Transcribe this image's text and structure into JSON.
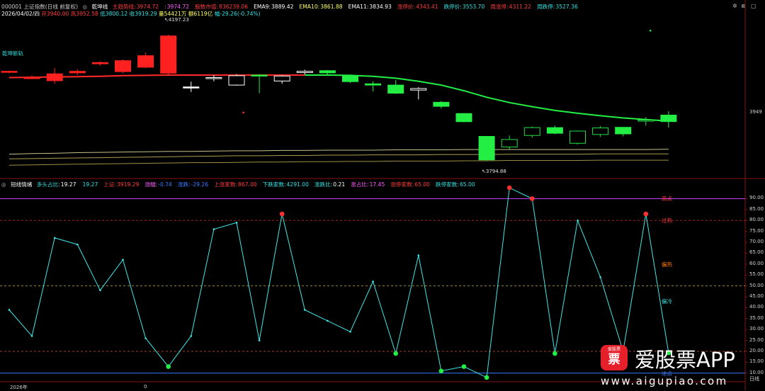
{
  "window": {
    "title": "000001 上证指数(日线 前复权)",
    "main_indicator": "乾坤线",
    "sub_indicator": "短线情绪"
  },
  "header_main": [
    {
      "label": "主趋势线:",
      "value": "3974.72",
      "color": "#ff3b3b",
      "lc": "#ff3b3b"
    },
    {
      "label": ":",
      "value": "3974.72",
      "color": "#ff5aff",
      "lc": "#ff5aff"
    },
    {
      "label": "股数市值:",
      "value": "836239.06",
      "color": "#ff3b3b",
      "lc": "#ff3b3b"
    },
    {
      "label": "EMA9:",
      "value": "3889.42",
      "color": "#ffffff",
      "lc": "#ffffff"
    },
    {
      "label": "EMA10:",
      "value": "3861.88",
      "color": "#ffff66",
      "lc": "#ffff66"
    },
    {
      "label": "EMA11:",
      "value": "3834.93",
      "color": "#ffffff",
      "lc": "#ffffff"
    },
    {
      "label": "涨停价:",
      "value": "4343.41",
      "color": "#ff3b3b",
      "lc": "#ff3b3b"
    },
    {
      "label": "跌停价:",
      "value": "3553.70",
      "color": "#33e0e0",
      "lc": "#33e0e0"
    },
    {
      "label": "周涨停:",
      "value": "4311.22",
      "color": "#ff3b3b",
      "lc": "#ff3b3b"
    },
    {
      "label": "周跌停:",
      "value": "3527.36",
      "color": "#33e0e0",
      "lc": "#33e0e0"
    }
  ],
  "bar_info": {
    "date": "2026/04/02/四",
    "open": "开3940.00",
    "high": "高3952.58",
    "low": "低3800.12",
    "close": "收3919.29",
    "volume": "量54421万",
    "amount": "额6119亿",
    "change": "幅-29.26(-0.74%)"
  },
  "header_sub": [
    {
      "label": "多头占比:",
      "value": "19.27",
      "color": "#ffffff",
      "lc": "#33e0e0"
    },
    {
      "label": "",
      "value": "19.27",
      "color": "#33e0e0",
      "lc": "#33e0e0"
    },
    {
      "label": "上证:",
      "value": "3919.29",
      "color": "#ff3b3b",
      "lc": "#ff3b3b"
    },
    {
      "label": "涨幅:",
      "value": "-0.74",
      "color": "#3b7bff",
      "lc": "#ff5aff"
    },
    {
      "label": "涨跌:",
      "value": "-29.26",
      "color": "#3b7bff",
      "lc": "#3b7bff"
    },
    {
      "label": "上涨家数:",
      "value": "867.00",
      "color": "#ff3b3b",
      "lc": "#ff3b3b"
    },
    {
      "label": "下跌家数:",
      "value": "4291.00",
      "color": "#33e0e0",
      "lc": "#33e0e0"
    },
    {
      "label": "涨跌比:",
      "value": "0.21",
      "color": "#ffffff",
      "lc": "#33e0e0"
    },
    {
      "label": "涨占比:",
      "value": "17.45",
      "color": "#ff5aff",
      "lc": "#ff5aff"
    },
    {
      "label": "涨停家数:",
      "value": "65.00",
      "color": "#ff3b3b",
      "lc": "#ff3b3b"
    },
    {
      "label": "跌停家数:",
      "value": "65.00",
      "color": "#33e0e0",
      "lc": "#33e0e0"
    }
  ],
  "annotations": {
    "high_label": "4197.23",
    "low_label": "3794.88",
    "left_tag": "乾坤新轨",
    "right_price": "3949"
  },
  "zones": [
    {
      "label": "高点",
      "level": 90,
      "color": "#ff3b3b"
    },
    {
      "label": "过热",
      "level": 80,
      "color": "#ff3b3b"
    },
    {
      "label": "偏热",
      "level": 60,
      "color": "#ff7a00"
    },
    {
      "label": "偏冷",
      "level": 43,
      "color": "#33e0e0"
    },
    {
      "label": "冰点",
      "level": 10,
      "color": "#3b7bff"
    }
  ],
  "x_axis": {
    "year": "2026年",
    "mid": "0",
    "right": "日线"
  },
  "logo": {
    "badge_char": "票",
    "badge_small": "爱股票",
    "main": "爱股票APP",
    "url": "www.aigupiao.com"
  },
  "chart_data": [
    {
      "type": "candlestick",
      "panel": "main",
      "ylim": [
        3760,
        4240
      ],
      "candles": [
        {
          "o": 4080,
          "c": 4078,
          "h": 4082,
          "l": 4074
        },
        {
          "o": 4060,
          "c": 4060,
          "h": 4067,
          "l": 4055
        },
        {
          "o": 4050,
          "c": 4072,
          "h": 4090,
          "l": 4040
        },
        {
          "o": 4075,
          "c": 4080,
          "h": 4087,
          "l": 4068
        },
        {
          "o": 4108,
          "c": 4104,
          "h": 4112,
          "l": 4098
        },
        {
          "o": 4079,
          "c": 4114,
          "h": 4118,
          "l": 4074
        },
        {
          "o": 4093,
          "c": 4130,
          "h": 4140,
          "l": 4090
        },
        {
          "o": 4193,
          "c": 4074,
          "h": 4197.23,
          "l": 4070
        },
        {
          "o": 4030,
          "c": 4028,
          "h": 4047,
          "l": 4014
        },
        {
          "o": 4058,
          "c": 4060,
          "h": 4068,
          "l": 4048
        },
        {
          "o": 4036,
          "c": 4066,
          "h": 4071,
          "l": 4034
        },
        {
          "o": 4068,
          "c": 4066,
          "h": 4071,
          "l": 4010
        },
        {
          "o": 4049,
          "c": 4065,
          "h": 4068,
          "l": 4040
        },
        {
          "o": 4076,
          "c": 4080,
          "h": 4085,
          "l": 4070
        },
        {
          "o": 4082,
          "c": 4075,
          "h": 4084,
          "l": 4069
        },
        {
          "o": 4066,
          "c": 4047,
          "h": 4070,
          "l": 4043
        },
        {
          "o": 4040,
          "c": 4036,
          "h": 4048,
          "l": 4016
        },
        {
          "o": 4036,
          "c": 4010,
          "h": 4052,
          "l": 4008
        },
        {
          "o": 4020,
          "c": 4025,
          "h": 4029,
          "l": 3990
        },
        {
          "o": 3981,
          "c": 3968,
          "h": 3985,
          "l": 3962
        },
        {
          "o": 3945,
          "c": 3919,
          "h": 3946,
          "l": 3917
        },
        {
          "o": 3872,
          "c": 3797,
          "h": 3873,
          "l": 3794.88
        },
        {
          "o": 3838,
          "c": 3862,
          "h": 3875,
          "l": 3830
        },
        {
          "o": 3875,
          "c": 3900,
          "h": 3904,
          "l": 3868
        },
        {
          "o": 3900,
          "c": 3882,
          "h": 3906,
          "l": 3879
        },
        {
          "o": 3850,
          "c": 3889,
          "h": 3891,
          "l": 3846
        },
        {
          "o": 3878,
          "c": 3899,
          "h": 3905,
          "l": 3870
        },
        {
          "o": 3901,
          "c": 3880,
          "h": 3902,
          "l": 3872
        },
        {
          "o": 3921,
          "c": 3924,
          "h": 3934,
          "l": 3906
        },
        {
          "o": 3940,
          "c": 3919.29,
          "h": 3952.58,
          "l": 3900.12
        }
      ],
      "trend_line": {
        "red_until": 13,
        "values": [
          4060,
          4061,
          4062,
          4063,
          4064,
          4066,
          4067,
          4068,
          4068,
          4068,
          4068,
          4068,
          4068,
          4068,
          4068,
          4067,
          4064,
          4058,
          4048,
          4036,
          4018,
          3997,
          3980,
          3967,
          3955,
          3946,
          3938,
          3931,
          3926,
          3921
        ]
      },
      "bands": [
        [
          3815,
          3817,
          3818,
          3820,
          3821,
          3822,
          3823,
          3824,
          3824,
          3825,
          3826,
          3826,
          3827,
          3827,
          3828,
          3828,
          3828,
          3829,
          3829,
          3829,
          3830,
          3830,
          3830,
          3830,
          3830,
          3830,
          3830,
          3830,
          3830,
          3831
        ],
        [
          3800,
          3801,
          3802,
          3803,
          3804,
          3805,
          3806,
          3807,
          3808,
          3809,
          3810,
          3810,
          3811,
          3811,
          3812,
          3812,
          3813,
          3813,
          3813,
          3814,
          3814,
          3814,
          3815,
          3815,
          3815,
          3815,
          3816,
          3816,
          3816,
          3816
        ],
        [
          3780,
          3781,
          3782,
          3783,
          3784,
          3785,
          3786,
          3787,
          3788,
          3788,
          3789,
          3790,
          3790,
          3791,
          3791,
          3792,
          3792,
          3793,
          3793,
          3793,
          3794,
          3794,
          3795,
          3795,
          3795,
          3795,
          3796,
          3796,
          3796,
          3796
        ]
      ],
      "stray_points": [
        {
          "i": 10.3,
          "v": 3948,
          "color": "#ff3030"
        },
        {
          "i": 28.2,
          "v": 4210,
          "color": "#22ee44"
        }
      ]
    },
    {
      "type": "line",
      "panel": "sub",
      "title": "短线情绪",
      "ylim": [
        7,
        96
      ],
      "yticks": [
        10,
        15,
        20,
        25,
        30,
        35,
        40,
        45,
        50,
        55,
        60,
        65,
        70,
        75,
        80,
        85,
        90
      ],
      "values": [
        39,
        27,
        72,
        69,
        48,
        62,
        26,
        13,
        27,
        76,
        79,
        25,
        83,
        39,
        34,
        29,
        52,
        19,
        64,
        11,
        13,
        8,
        95,
        90,
        19,
        80,
        54,
        20,
        83,
        19.27
      ],
      "markers": [
        {
          "i": 7,
          "color": "#22ee44"
        },
        {
          "i": 12,
          "color": "#ff3030"
        },
        {
          "i": 17,
          "color": "#22ee44"
        },
        {
          "i": 19,
          "color": "#22ee44"
        },
        {
          "i": 20,
          "color": "#22ee44"
        },
        {
          "i": 21,
          "color": "#22ee44"
        },
        {
          "i": 22,
          "color": "#ff3030"
        },
        {
          "i": 23,
          "color": "#ff3030"
        },
        {
          "i": 24,
          "color": "#22ee44"
        },
        {
          "i": 28,
          "color": "#ff3030"
        },
        {
          "i": 29,
          "color": "#22ee44"
        }
      ],
      "ref_lines": [
        {
          "v": 90,
          "color": "#c040ff",
          "style": "solid"
        },
        {
          "v": 80,
          "color": "#aa2020",
          "style": "dashed"
        },
        {
          "v": 50,
          "color": "#9a8a30",
          "style": "dashed"
        },
        {
          "v": 20,
          "color": "#aa4020",
          "style": "dashed"
        },
        {
          "v": 10,
          "color": "#3b7bff",
          "style": "solid"
        }
      ]
    }
  ]
}
